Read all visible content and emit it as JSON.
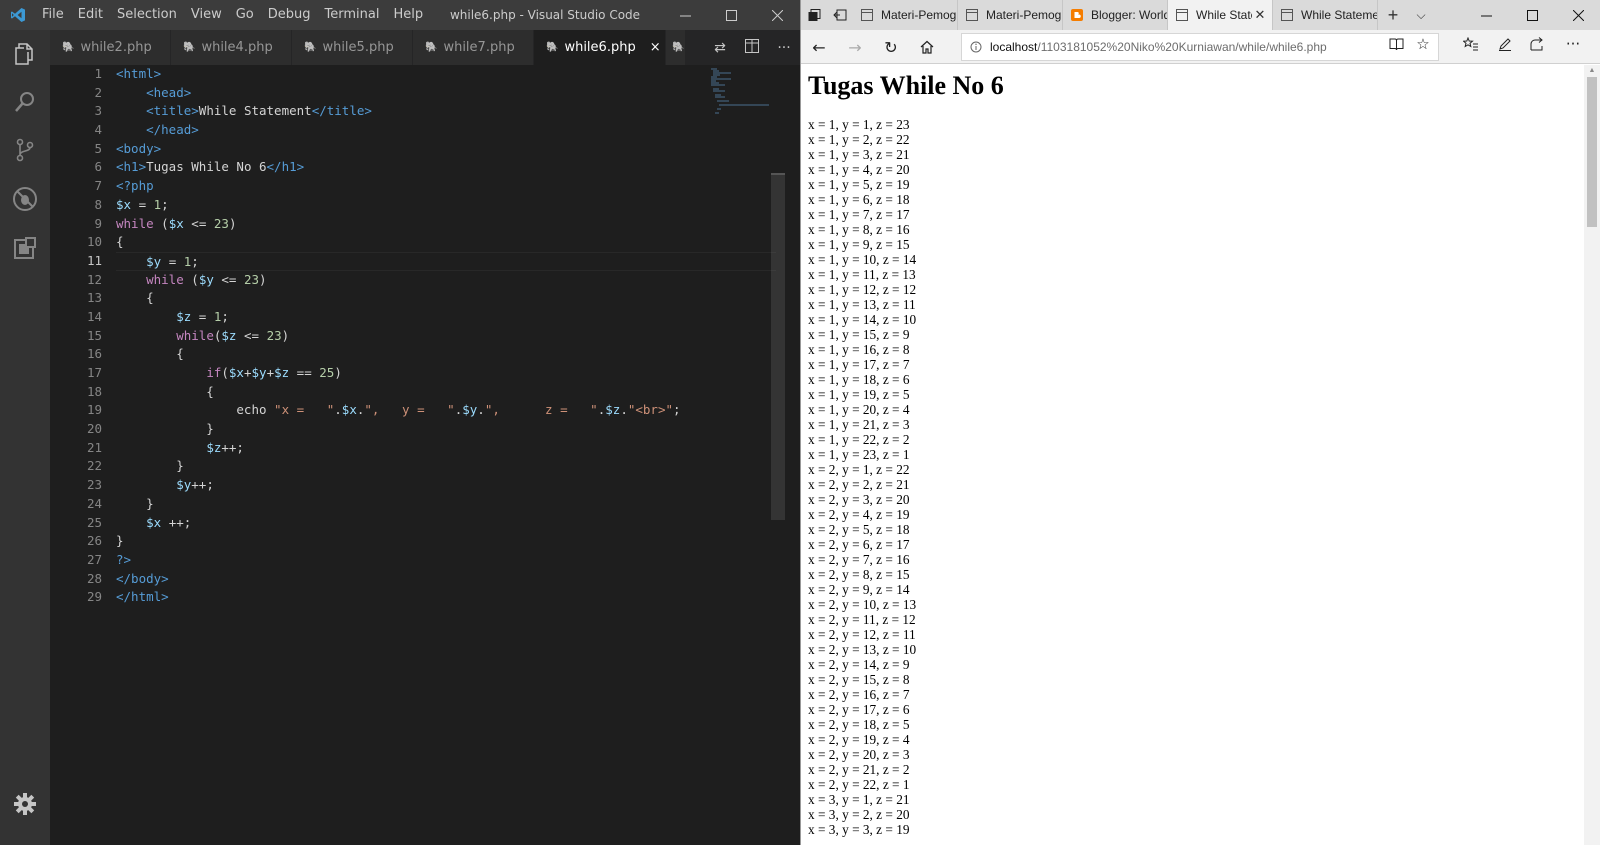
{
  "vscode": {
    "window_title": "while6.php - Visual Studio Code",
    "menu": [
      "File",
      "Edit",
      "Selection",
      "View",
      "Go",
      "Debug",
      "Terminal",
      "Help"
    ],
    "tabs": [
      {
        "label": "while2.php",
        "active": false
      },
      {
        "label": "while4.php",
        "active": false
      },
      {
        "label": "while5.php",
        "active": false
      },
      {
        "label": "while7.php",
        "active": false
      },
      {
        "label": "while6.php",
        "active": true
      }
    ],
    "tab_close": "×",
    "more_actions": "···",
    "current_line": 11,
    "code_lines": [
      [
        [
          "tag",
          "<html>"
        ]
      ],
      [
        [
          "txt",
          "    "
        ],
        [
          "tag",
          "<head>"
        ]
      ],
      [
        [
          "txt",
          "    "
        ],
        [
          "tag",
          "<title>"
        ],
        [
          "txt",
          "While Statement"
        ],
        [
          "tag",
          "</title>"
        ]
      ],
      [
        [
          "txt",
          "    "
        ],
        [
          "tag",
          "</head>"
        ]
      ],
      [
        [
          "tag",
          "<body>"
        ]
      ],
      [
        [
          "tag",
          "<h1>"
        ],
        [
          "txt",
          "Tugas While No 6"
        ],
        [
          "tag",
          "</h1>"
        ]
      ],
      [
        [
          "tag",
          "<?php"
        ]
      ],
      [
        [
          "var",
          "$x"
        ],
        [
          "txt",
          " = "
        ],
        [
          "num",
          "1"
        ],
        [
          "txt",
          ";"
        ]
      ],
      [
        [
          "kw",
          "while"
        ],
        [
          "txt",
          " ("
        ],
        [
          "var",
          "$x"
        ],
        [
          "txt",
          " <= "
        ],
        [
          "num",
          "23"
        ],
        [
          "txt",
          ")"
        ]
      ],
      [
        [
          "txt",
          "{"
        ]
      ],
      [
        [
          "txt",
          "    "
        ],
        [
          "var",
          "$y"
        ],
        [
          "txt",
          " = "
        ],
        [
          "num",
          "1"
        ],
        [
          "txt",
          ";"
        ]
      ],
      [
        [
          "txt",
          "    "
        ],
        [
          "kw",
          "while"
        ],
        [
          "txt",
          " ("
        ],
        [
          "var",
          "$y"
        ],
        [
          "txt",
          " <= "
        ],
        [
          "num",
          "23"
        ],
        [
          "txt",
          ")"
        ]
      ],
      [
        [
          "txt",
          "    {"
        ]
      ],
      [
        [
          "txt",
          "        "
        ],
        [
          "var",
          "$z"
        ],
        [
          "txt",
          " = "
        ],
        [
          "num",
          "1"
        ],
        [
          "txt",
          ";"
        ]
      ],
      [
        [
          "txt",
          "        "
        ],
        [
          "kw",
          "while"
        ],
        [
          "txt",
          "("
        ],
        [
          "var",
          "$z"
        ],
        [
          "txt",
          " <= "
        ],
        [
          "num",
          "23"
        ],
        [
          "txt",
          ")"
        ]
      ],
      [
        [
          "txt",
          "        {"
        ]
      ],
      [
        [
          "txt",
          "            "
        ],
        [
          "kw",
          "if"
        ],
        [
          "txt",
          "("
        ],
        [
          "var",
          "$x"
        ],
        [
          "txt",
          "+"
        ],
        [
          "var",
          "$y"
        ],
        [
          "txt",
          "+"
        ],
        [
          "var",
          "$z"
        ],
        [
          "txt",
          " == "
        ],
        [
          "num",
          "25"
        ],
        [
          "txt",
          ")"
        ]
      ],
      [
        [
          "txt",
          "            {"
        ]
      ],
      [
        [
          "txt",
          "                echo "
        ],
        [
          "str",
          "\"x =   \""
        ],
        [
          "txt",
          "."
        ],
        [
          "var",
          "$x"
        ],
        [
          "txt",
          "."
        ],
        [
          "str",
          "\",   y =   \""
        ],
        [
          "txt",
          "."
        ],
        [
          "var",
          "$y"
        ],
        [
          "txt",
          "."
        ],
        [
          "str",
          "\",      z =   \""
        ],
        [
          "txt",
          "."
        ],
        [
          "var",
          "$z"
        ],
        [
          "txt",
          "."
        ],
        [
          "str",
          "\"<br>\""
        ],
        [
          "txt",
          ";"
        ]
      ],
      [
        [
          "txt",
          "            }"
        ]
      ],
      [
        [
          "txt",
          "            "
        ],
        [
          "var",
          "$z"
        ],
        [
          "txt",
          "++;"
        ]
      ],
      [
        [
          "txt",
          "        }"
        ]
      ],
      [
        [
          "txt",
          "        "
        ],
        [
          "var",
          "$y"
        ],
        [
          "txt",
          "++;"
        ]
      ],
      [
        [
          "txt",
          "    }"
        ]
      ],
      [
        [
          "txt",
          "    "
        ],
        [
          "var",
          "$x"
        ],
        [
          "txt",
          " ++;"
        ]
      ],
      [
        [
          "txt",
          "}"
        ]
      ],
      [
        [
          "tag",
          "?>"
        ]
      ],
      [
        [
          "tag",
          "</body>"
        ]
      ],
      [
        [
          "tag",
          "</html>"
        ]
      ]
    ]
  },
  "edge": {
    "tabs": [
      {
        "label": "Materi-Pemogr",
        "icon": "page-icon",
        "active": false
      },
      {
        "label": "Materi-Pemogr",
        "icon": "page-icon",
        "active": false
      },
      {
        "label": "Blogger: World",
        "icon": "blogger-icon",
        "active": false
      },
      {
        "label": "While State",
        "icon": "page-icon",
        "active": true
      },
      {
        "label": "While Statemer",
        "icon": "page-icon",
        "active": false
      }
    ],
    "address_host": "localhost",
    "address_path": "/1103181052%20Niko%20Kurniawan/while/while6.php",
    "page_heading": "Tugas While No 6",
    "output_lines": [
      "x = 1, y = 1, z = 23",
      "x = 1, y = 2, z = 22",
      "x = 1, y = 3, z = 21",
      "x = 1, y = 4, z = 20",
      "x = 1, y = 5, z = 19",
      "x = 1, y = 6, z = 18",
      "x = 1, y = 7, z = 17",
      "x = 1, y = 8, z = 16",
      "x = 1, y = 9, z = 15",
      "x = 1, y = 10, z = 14",
      "x = 1, y = 11, z = 13",
      "x = 1, y = 12, z = 12",
      "x = 1, y = 13, z = 11",
      "x = 1, y = 14, z = 10",
      "x = 1, y = 15, z = 9",
      "x = 1, y = 16, z = 8",
      "x = 1, y = 17, z = 7",
      "x = 1, y = 18, z = 6",
      "x = 1, y = 19, z = 5",
      "x = 1, y = 20, z = 4",
      "x = 1, y = 21, z = 3",
      "x = 1, y = 22, z = 2",
      "x = 1, y = 23, z = 1",
      "x = 2, y = 1, z = 22",
      "x = 2, y = 2, z = 21",
      "x = 2, y = 3, z = 20",
      "x = 2, y = 4, z = 19",
      "x = 2, y = 5, z = 18",
      "x = 2, y = 6, z = 17",
      "x = 2, y = 7, z = 16",
      "x = 2, y = 8, z = 15",
      "x = 2, y = 9, z = 14",
      "x = 2, y = 10, z = 13",
      "x = 2, y = 11, z = 12",
      "x = 2, y = 12, z = 11",
      "x = 2, y = 13, z = 10",
      "x = 2, y = 14, z = 9",
      "x = 2, y = 15, z = 8",
      "x = 2, y = 16, z = 7",
      "x = 2, y = 17, z = 6",
      "x = 2, y = 18, z = 5",
      "x = 2, y = 19, z = 4",
      "x = 2, y = 20, z = 3",
      "x = 2, y = 21, z = 2",
      "x = 2, y = 22, z = 1",
      "x = 3, y = 1, z = 21",
      "x = 3, y = 2, z = 20",
      "x = 3, y = 3, z = 19"
    ]
  }
}
